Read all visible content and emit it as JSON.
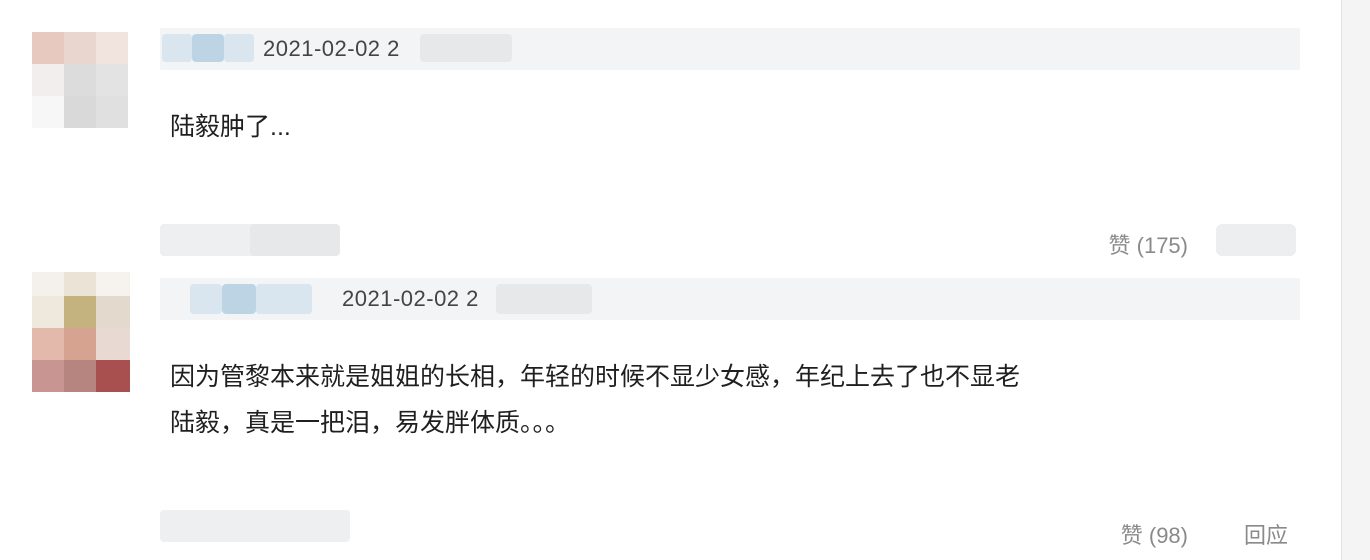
{
  "comments": [
    {
      "timestamp": "2021-02-02 2",
      "text_lines": [
        "陆毅肿了..."
      ],
      "like_label": "赞 (175)"
    },
    {
      "timestamp": "2021-02-02 2",
      "text_lines": [
        "因为管黎本来就是姐姐的长相，年轻的时候不显少女感，年纪上去了也不显老",
        "陆毅，真是一把泪，易发胖体质。。。"
      ],
      "like_label": "赞 (98)",
      "reply_label": "回应"
    }
  ],
  "colors": {
    "header_bg": "#f2f4f6",
    "action_text": "#8a8a8a",
    "body_text": "#1f1f1f"
  }
}
